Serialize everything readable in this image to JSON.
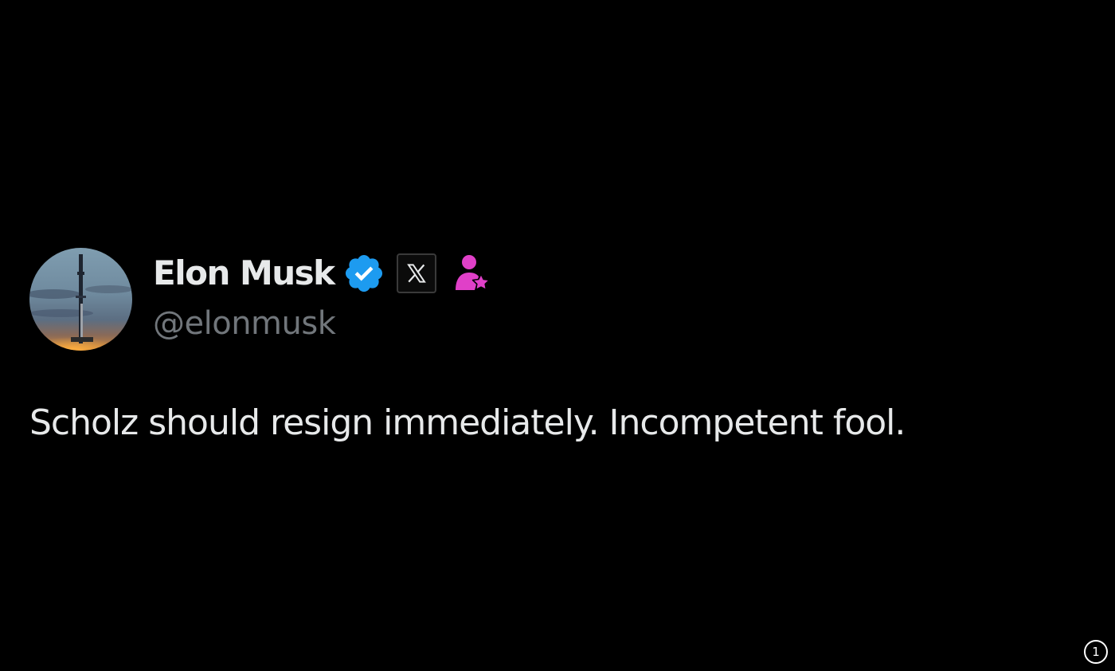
{
  "tweet": {
    "author": {
      "display_name": "Elon Musk",
      "handle": "@elonmusk",
      "avatar": "avatar-image",
      "badges": {
        "verified_icon": "verified-badge-icon",
        "affiliate_icon": "x-logo-icon",
        "subscriber_icon": "person-star-icon"
      }
    },
    "text": "Scholz should resign immediately. Incompetent fool."
  },
  "page_indicator": "1",
  "colors": {
    "background": "#000000",
    "primary_text": "#e7e9ea",
    "secondary_text": "#71767b",
    "verified_blue": "#1d9bf0",
    "subscriber_pink": "#e040c8"
  }
}
